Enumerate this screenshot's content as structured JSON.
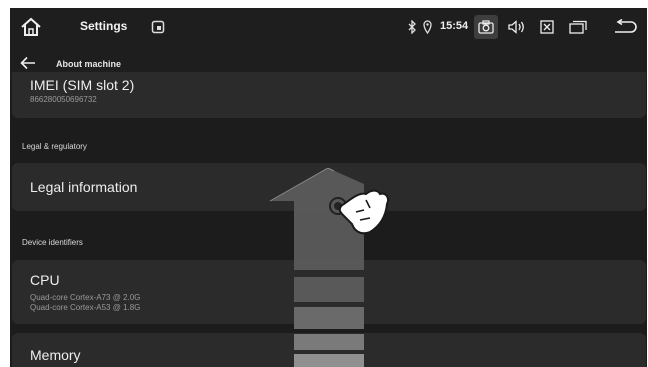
{
  "statusbar": {
    "title": "Settings",
    "time": "15:54",
    "icons": [
      "home-icon",
      "app-icon",
      "bluetooth-icon",
      "location-icon",
      "camera-icon",
      "volume-icon",
      "close-window-icon",
      "recents-icon",
      "back-icon"
    ]
  },
  "appbar": {
    "title": "About machine"
  },
  "imei": {
    "title": "IMEI (SIM slot 2)",
    "value": "866280050696732"
  },
  "sections": {
    "legal": "Legal & regulatory",
    "device": "Device identifiers"
  },
  "legal_info": {
    "title": "Legal information"
  },
  "cpu": {
    "title": "CPU",
    "line1": "Quad-core Cortex-A73 @ 2.0G",
    "line2": "Quad-core Cortex-A53 @ 1.8G"
  },
  "memory": {
    "title": "Memory"
  },
  "overlay": {
    "gesture": "swipe-up-hand-icon"
  },
  "colors": {
    "background": "#1c1c1c",
    "card": "#2b2b2b",
    "arrow": "#5a5a5a"
  }
}
